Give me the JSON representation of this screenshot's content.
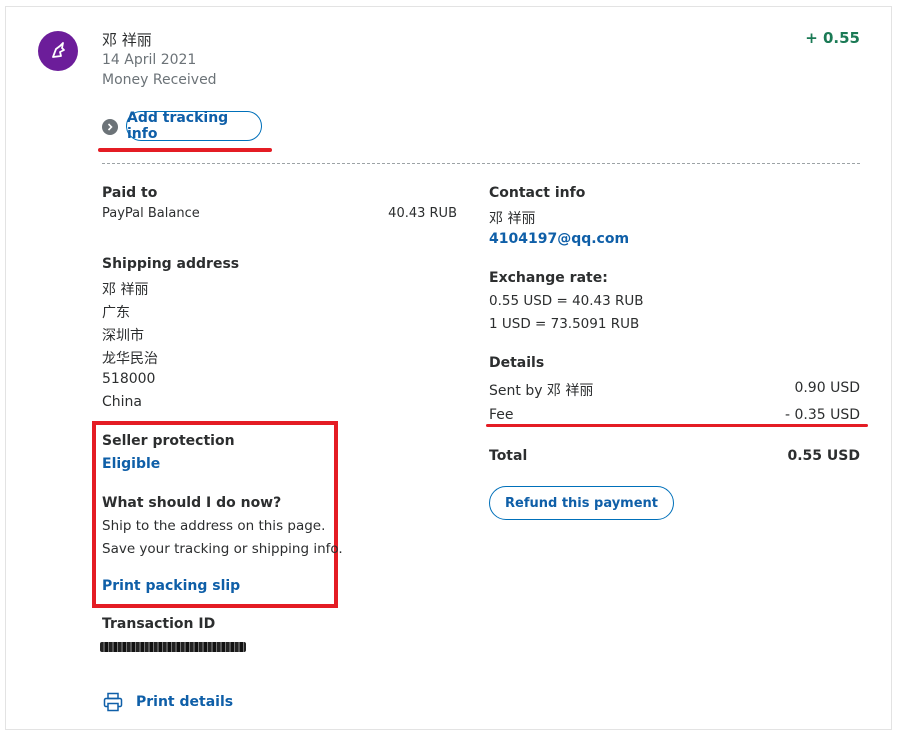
{
  "header": {
    "name": "邓 祥丽",
    "date": "14 April 2021",
    "type": "Money Received",
    "amount": "+ 0.55",
    "track_button": "Add tracking info"
  },
  "paid_to": {
    "label": "Paid to",
    "method": "PayPal Balance",
    "amount": "40.43 RUB"
  },
  "shipping": {
    "label": "Shipping address",
    "lines": [
      "邓 祥丽",
      "广东",
      "深圳市",
      "龙华民治",
      "518000",
      "China"
    ]
  },
  "seller_protection": {
    "label": "Seller protection",
    "status": "Eligible",
    "question": "What should I do now?",
    "line1": "Ship to the address on this page.",
    "line2": "Save your tracking or shipping info.",
    "print_slip": "Print packing slip"
  },
  "transaction": {
    "label": "Transaction ID"
  },
  "print_details": "Print details",
  "contact": {
    "label": "Contact info",
    "name": "邓 祥丽",
    "email": "4104197@qq.com"
  },
  "exchange": {
    "label": "Exchange rate:",
    "line1": "0.55 USD = 40.43 RUB",
    "line2": "1 USD = 73.5091 RUB"
  },
  "details": {
    "label": "Details",
    "sent_label": "Sent by 邓 祥丽",
    "sent_value": "0.90 USD",
    "fee_label": "Fee",
    "fee_value": "- 0.35 USD",
    "total_label": "Total",
    "total_value": "0.55 USD"
  },
  "refund_button": "Refund this payment",
  "colors": {
    "accent_blue": "#0f5fa8",
    "positive_green": "#1b7a55",
    "highlight_red": "#e41c24",
    "avatar_purple": "#6c1d9a"
  }
}
